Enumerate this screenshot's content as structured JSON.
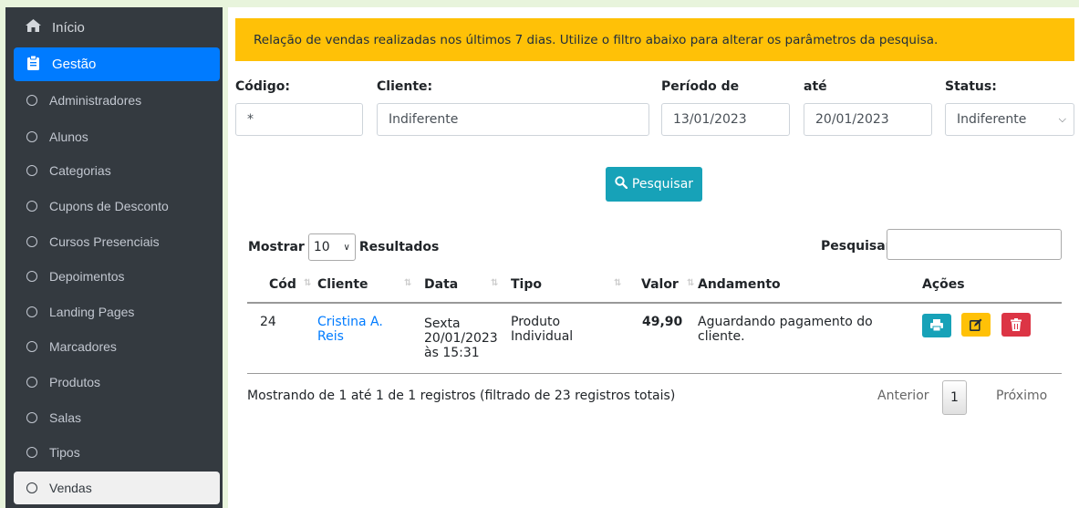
{
  "sidebar": {
    "home_label": "Início",
    "section_label": "Gestão",
    "items": [
      {
        "label": "Administradores"
      },
      {
        "label": "Alunos"
      },
      {
        "label": "Categorias"
      },
      {
        "label": "Cupons de Desconto"
      },
      {
        "label": "Cursos Presenciais"
      },
      {
        "label": "Depoimentos"
      },
      {
        "label": "Landing Pages"
      },
      {
        "label": "Marcadores"
      },
      {
        "label": "Produtos"
      },
      {
        "label": "Salas"
      },
      {
        "label": "Tipos"
      },
      {
        "label": "Vendas"
      }
    ],
    "active_item": "Vendas"
  },
  "alert": {
    "text": "Relação de vendas realizadas nos últimos 7 dias. Utilize o filtro abaixo para alterar os parâmetros da pesquisa."
  },
  "filters": {
    "codigo_label": "Código:",
    "codigo_value": "*",
    "cliente_label": "Cliente:",
    "cliente_value": "Indiferente",
    "periodo_label": "Período de",
    "periodo_de_value": "13/01/2023",
    "ate_label": "até",
    "periodo_ate_value": "20/01/2023",
    "status_label": "Status:",
    "status_value": "Indiferente"
  },
  "search_button": {
    "label": "Pesquisar"
  },
  "table_controls": {
    "show_label": "Mostrar",
    "page_size": "10",
    "results_label": "Resultados",
    "search_label": "Pesquisar:"
  },
  "table": {
    "headers": [
      "Cód",
      "Cliente",
      "Data",
      "Tipo",
      "Valor",
      "Andamento",
      "Ações"
    ],
    "rows": [
      {
        "cod": "24",
        "cliente_l1": "Cristina A.",
        "cliente_l2": "Reis",
        "data_l1": "Sexta",
        "data_l2": "20/01/2023",
        "data_l3": "às 15:31",
        "tipo_l1": "Produto",
        "tipo_l2": "Individual",
        "valor": "49,90",
        "andamento_l1": "Aguardando pagamento do",
        "andamento_l2": "cliente."
      }
    ]
  },
  "footer": {
    "info": "Mostrando de 1 até 1 de 1 registros (filtrado de 23 registros totais)",
    "prev": "Anterior",
    "page": "1",
    "next": "Próximo"
  },
  "colors": {
    "sidebar_bg": "#343a40",
    "primary": "#007bff",
    "warning": "#ffc107",
    "info": "#17a2b8",
    "danger": "#dc3545"
  }
}
